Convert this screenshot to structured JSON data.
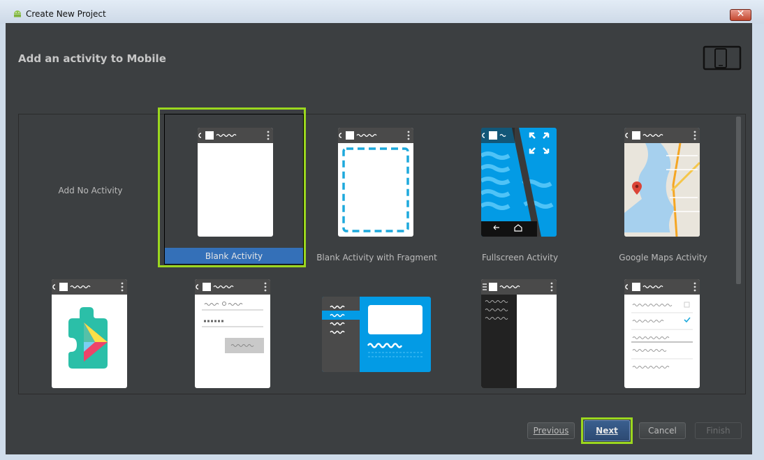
{
  "window": {
    "title": "Create New Project",
    "close_glyph": "✕"
  },
  "page": {
    "heading": "Add an activity to Mobile"
  },
  "activities": [
    {
      "label": "Add No Activity"
    },
    {
      "label": "Blank Activity",
      "selected": true
    },
    {
      "label": "Blank Activity with Fragment"
    },
    {
      "label": "Fullscreen Activity"
    },
    {
      "label": "Google Maps Activity"
    }
  ],
  "buttons": {
    "previous": "Previous",
    "next": "Next",
    "cancel": "Cancel",
    "finish": "Finish"
  },
  "icons": {
    "window": "android-icon",
    "device": "phone-tablet-icon",
    "play_services": "google-play-services-icon",
    "fullscreen": "expand-icon",
    "map_marker": "map-pin-icon"
  },
  "colors": {
    "accent_highlight": "#9bd71e",
    "selection": "#3470b8",
    "background": "#3c3f41",
    "android_blue": "#039be5"
  }
}
